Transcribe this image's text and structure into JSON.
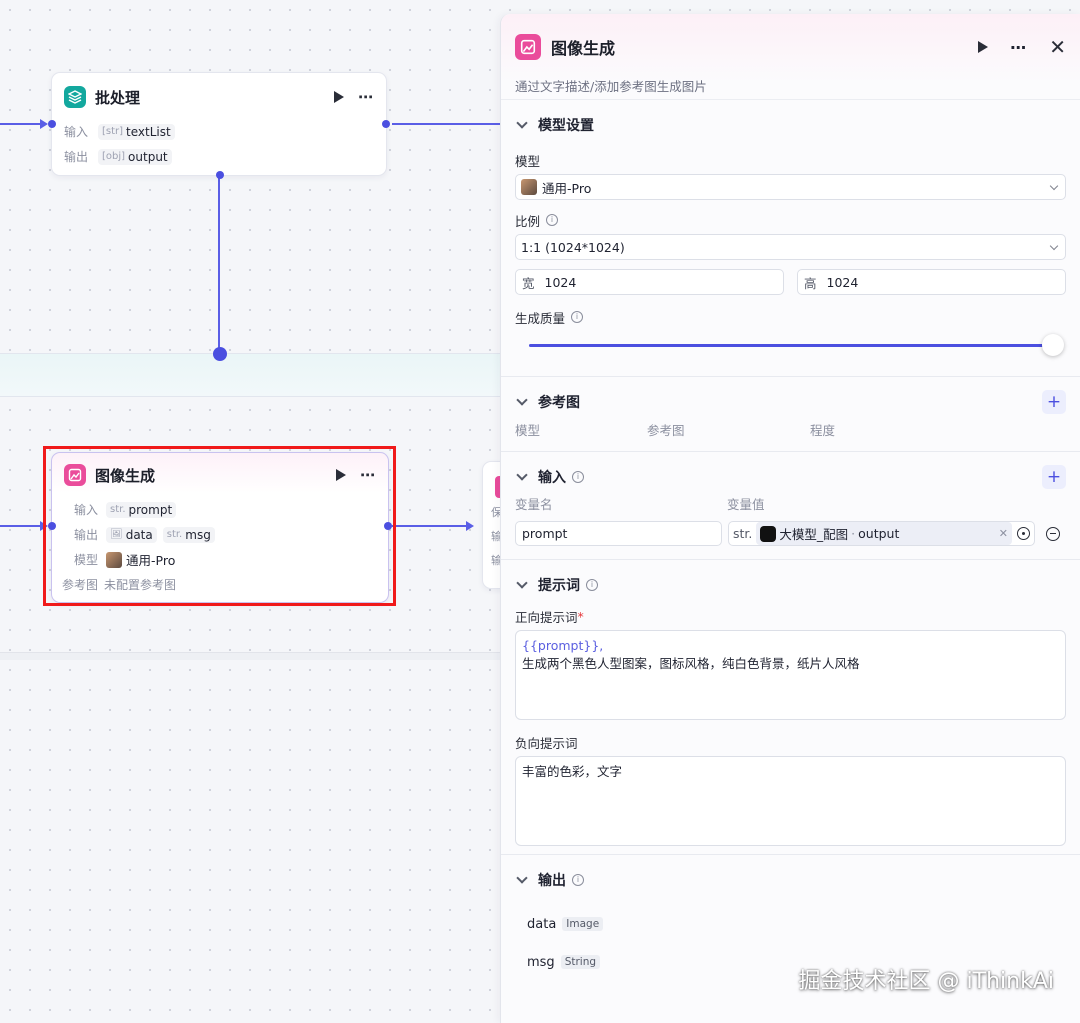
{
  "canvas": {
    "batch_node": {
      "title": "批处理",
      "input_label": "输入",
      "input_type": "[str]",
      "input_value": "textList",
      "output_label": "输出",
      "output_type": "[obj]",
      "output_value": "output"
    },
    "image_node": {
      "title": "图像生成",
      "input_label": "输入",
      "input_type": "str.",
      "input_value": "prompt",
      "output_label": "输出",
      "output_data": "data",
      "output_msg_type": "str.",
      "output_msg": "msg",
      "model_label": "模型",
      "model_value": "通用-Pro",
      "ref_label": "参考图",
      "ref_value": "未配置参考图"
    },
    "partial_node": {
      "line1": "保",
      "line2": "输",
      "line3": "输"
    }
  },
  "panel": {
    "title": "图像生成",
    "description": "通过文字描述/添加参考图生成图片",
    "model_section": {
      "title": "模型设置",
      "model_label": "模型",
      "model_value": "通用-Pro",
      "ratio_label": "比例",
      "ratio_value": "1:1 (1024*1024)",
      "width_label": "宽",
      "width_value": "1024",
      "height_label": "高",
      "height_value": "1024",
      "quality_label": "生成质量",
      "quality_level": 1.0
    },
    "ref_section": {
      "title": "参考图",
      "col_model": "模型",
      "col_ref": "参考图",
      "col_degree": "程度"
    },
    "input_section": {
      "title": "输入",
      "col_name": "变量名",
      "col_value": "变量值",
      "var_name": "prompt",
      "var_type": "str.",
      "var_source": "大模型_配图",
      "var_sep": "·",
      "var_field": "output"
    },
    "prompt_section": {
      "title": "提示词",
      "positive_label": "正向提示词",
      "required_mark": "*",
      "positive_var": "{{prompt}},",
      "positive_text": "生成两个黑色人型图案，图标风格，纯白色背景，纸片人风格",
      "negative_label": "负向提示词",
      "negative_text": "丰富的色彩，文字"
    },
    "output_section": {
      "title": "输出",
      "items": [
        {
          "name": "data",
          "type": "Image"
        },
        {
          "name": "msg",
          "type": "String"
        }
      ]
    }
  },
  "watermark": "掘金技术社区 @ iThinkAi",
  "colors": {
    "accent": "#4b4fe0",
    "highlight": "#f01a1a",
    "teal_icon": "#13a89e",
    "pink_icon": "#ea4c9b"
  }
}
